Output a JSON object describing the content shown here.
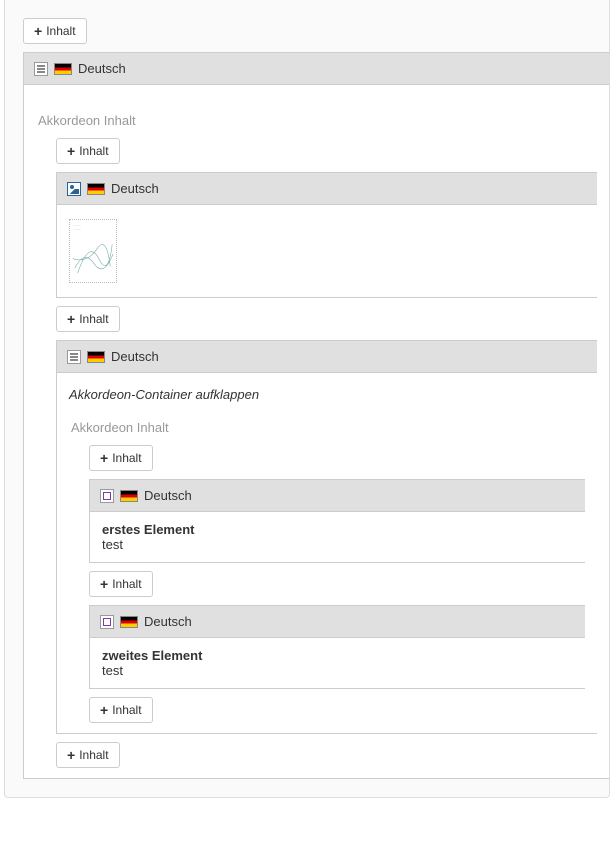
{
  "buttons": {
    "add_content": "Inhalt"
  },
  "lang": {
    "label": "Deutsch"
  },
  "section": {
    "accordion_content": "Akkordeon Inhalt"
  },
  "block_image": {
    "lang": "Deutsch"
  },
  "block_accordion_inner": {
    "lang": "Deutsch",
    "expand_hint": "Akkordeon-Container aufklappen"
  },
  "items": [
    {
      "lang": "Deutsch",
      "title": "erstes Element",
      "body": "test"
    },
    {
      "lang": "Deutsch",
      "title": "zweites Element",
      "body": "test"
    }
  ]
}
